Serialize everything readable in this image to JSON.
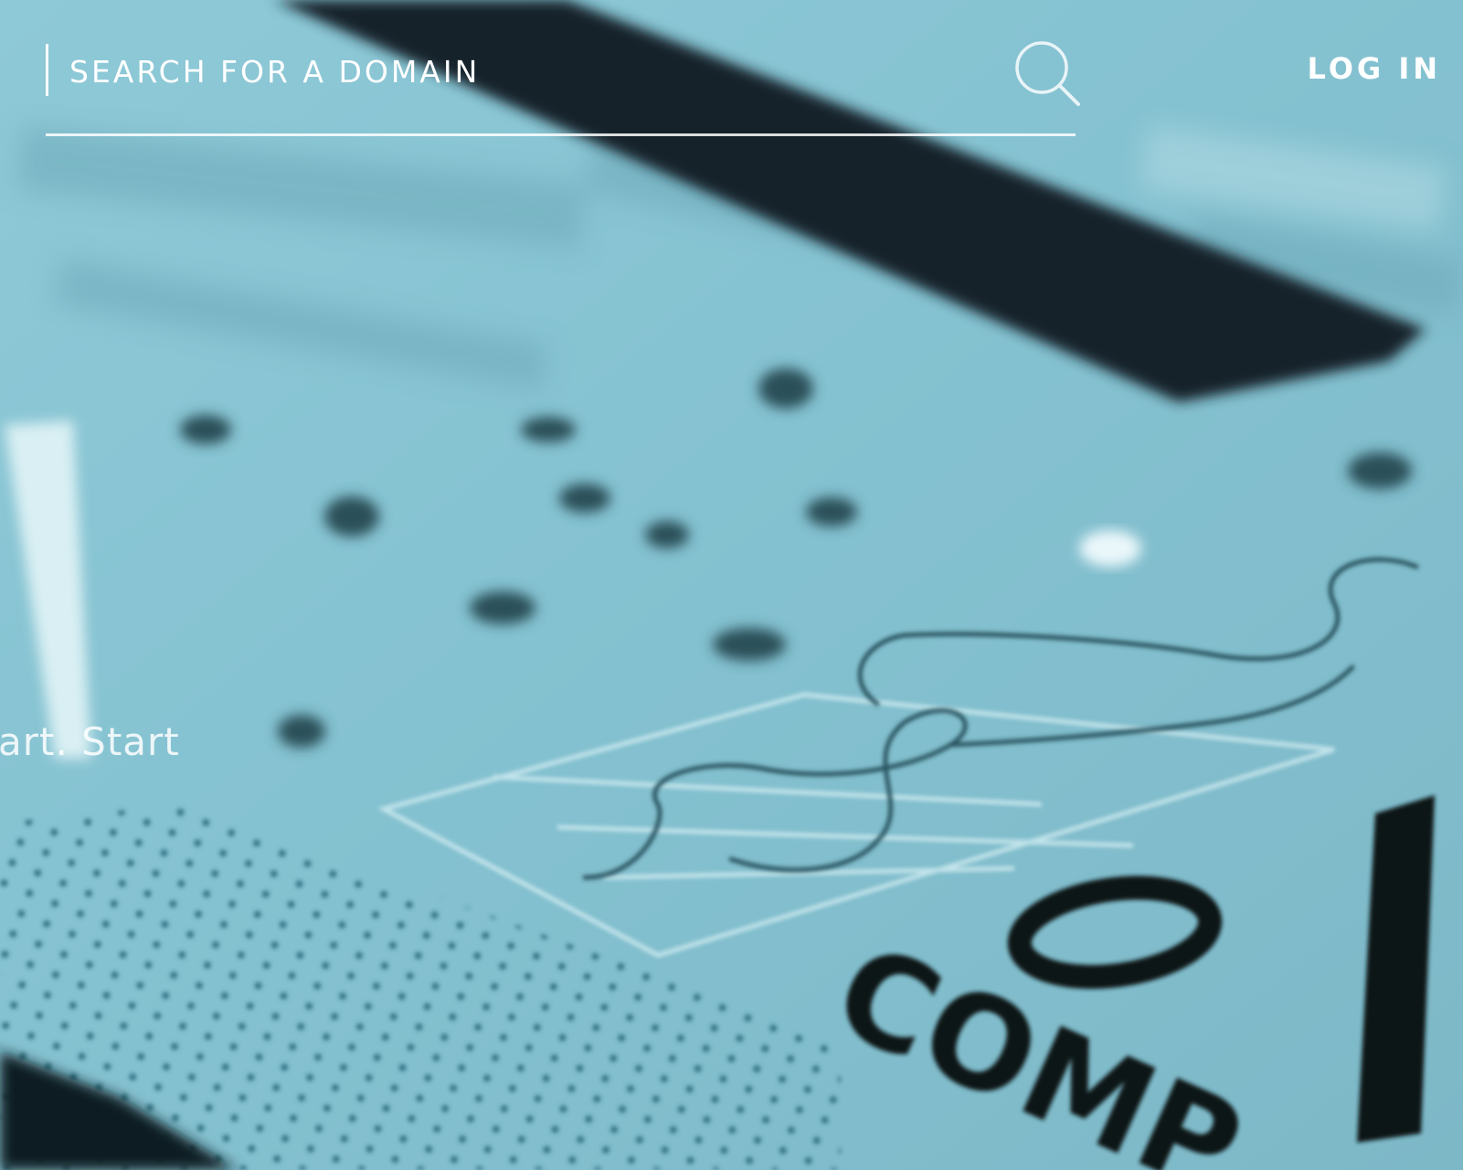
{
  "search": {
    "placeholder": "SEARCH FOR A DOMAIN",
    "button_icon": "search-icon"
  },
  "header": {
    "login_label": "LOG IN"
  },
  "hero": {
    "tagline_fragment": "art. Start"
  },
  "background": {
    "description_icon": "blurred-check-photo",
    "base_color": "#86c2d1",
    "accent_color": "#17262c"
  }
}
